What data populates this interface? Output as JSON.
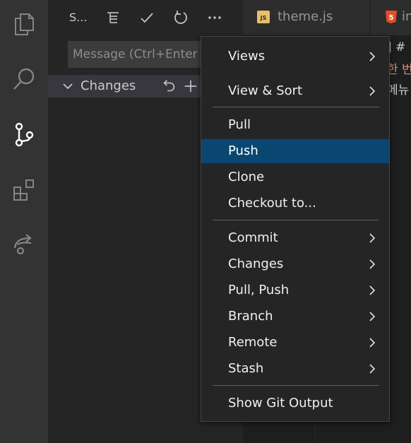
{
  "sidebar": {
    "title": "S...",
    "message_placeholder": "Message (Ctrl+Enter",
    "changes_label": "Changes"
  },
  "editor": {
    "tabs": [
      {
        "label": "theme.js",
        "icon_text": "JS",
        "icon_color": "#e8bf6a"
      },
      {
        "label": "in",
        "icon_text": "5",
        "icon_color": "#e44d26"
      }
    ],
    "visible_code": [
      {
        "text": "] #",
        "color": "#cccccc"
      },
      {
        "text": "한 번",
        "color": "#ce9178"
      },
      {
        "text": "메뉴",
        "color": "#cccccc"
      }
    ]
  },
  "menu": {
    "groups": [
      [
        {
          "label": "Views",
          "submenu": true
        },
        {
          "label": "View & Sort",
          "submenu": true
        }
      ],
      [
        {
          "label": "Pull",
          "submenu": false
        },
        {
          "label": "Push",
          "submenu": false,
          "highlighted": true
        },
        {
          "label": "Clone",
          "submenu": false
        },
        {
          "label": "Checkout to...",
          "submenu": false
        }
      ],
      [
        {
          "label": "Commit",
          "submenu": true
        },
        {
          "label": "Changes",
          "submenu": true
        },
        {
          "label": "Pull, Push",
          "submenu": true
        },
        {
          "label": "Branch",
          "submenu": true
        },
        {
          "label": "Remote",
          "submenu": true
        },
        {
          "label": "Stash",
          "submenu": true
        }
      ],
      [
        {
          "label": "Show Git Output",
          "submenu": false
        }
      ]
    ]
  },
  "colors": {
    "accent_highlight": "#094771",
    "activity_bar": "#333333",
    "sidebar": "#252526"
  }
}
